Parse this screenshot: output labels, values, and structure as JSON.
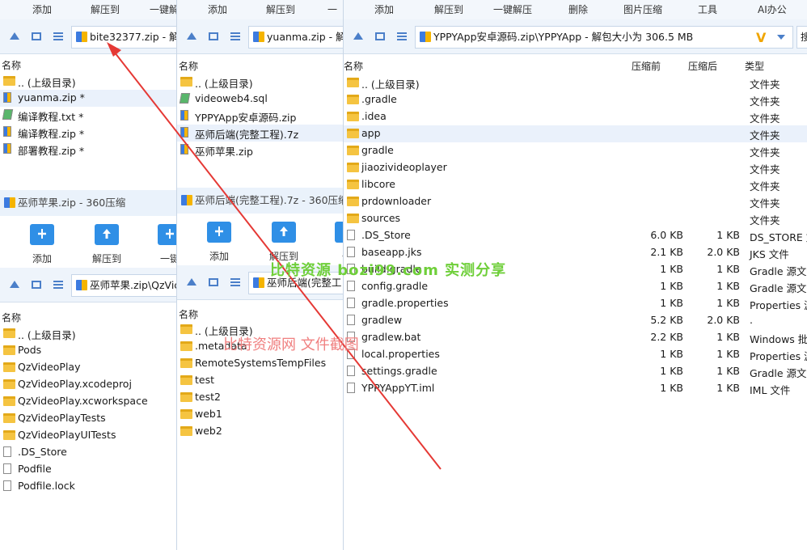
{
  "win1": {
    "toolbar": [
      "添加",
      "解压到",
      "一键解"
    ],
    "path": "bite32377.zip - 解",
    "col_name": "名称",
    "files": [
      {
        "name": ".. (上级目录)",
        "type": "folder"
      },
      {
        "name": "yuanma.zip *",
        "type": "zip",
        "selected": true
      },
      {
        "name": "编译教程.txt *",
        "type": "txt"
      },
      {
        "name": "编译教程.zip *",
        "type": "zip"
      },
      {
        "name": "部署教程.zip *",
        "type": "zip"
      }
    ]
  },
  "win2": {
    "toolbar": [
      "添加",
      "解压到",
      "一"
    ],
    "path": "yuanma.zip - 解",
    "col_name": "名称",
    "files": [
      {
        "name": ".. (上级目录)",
        "type": "folder"
      },
      {
        "name": "videoweb4.sql",
        "type": "txt"
      },
      {
        "name": "YPPYApp安卓源码.zip",
        "type": "zip"
      },
      {
        "name": "巫师后端(完整工程).7z",
        "type": "zip",
        "selected": true
      },
      {
        "name": "巫师苹果.zip",
        "type": "zip"
      }
    ]
  },
  "win3": {
    "title": "巫师苹果.zip - 360压缩",
    "buttons": [
      "添加",
      "解压到",
      "一键"
    ],
    "path": "巫师苹果.zip\\QzVic",
    "col_name": "名称",
    "files": [
      {
        "name": ".. (上级目录)",
        "type": "folder"
      },
      {
        "name": "Pods",
        "type": "folder"
      },
      {
        "name": "QzVideoPlay",
        "type": "folder"
      },
      {
        "name": "QzVideoPlay.xcodeproj",
        "type": "folder"
      },
      {
        "name": "QzVideoPlay.xcworkspace",
        "type": "folder"
      },
      {
        "name": "QzVideoPlayTests",
        "type": "folder"
      },
      {
        "name": "QzVideoPlayUITests",
        "type": "folder"
      },
      {
        "name": ".DS_Store",
        "type": "file"
      },
      {
        "name": "Podfile",
        "type": "file"
      },
      {
        "name": "Podfile.lock",
        "type": "file"
      }
    ]
  },
  "win4": {
    "title": "巫师后端(完整工程).7z - 360压缩",
    "buttons": [
      "添加",
      "解压到",
      "一"
    ],
    "path": "巫师后端(完整工",
    "col_name": "名称",
    "files": [
      {
        "name": ".. (上级目录)",
        "type": "folder"
      },
      {
        "name": ".metadata",
        "type": "folder"
      },
      {
        "name": "RemoteSystemsTempFiles",
        "type": "folder"
      },
      {
        "name": "test",
        "type": "folder"
      },
      {
        "name": "test2",
        "type": "folder"
      },
      {
        "name": "web1",
        "type": "folder"
      },
      {
        "name": "web2",
        "type": "folder"
      }
    ]
  },
  "win5": {
    "toolbar": [
      "添加",
      "解压到",
      "一键解压",
      "删除",
      "图片压缩",
      "工具",
      "AI办公"
    ],
    "path": "YPPYApp安卓源码.zip\\YPPYApp - 解包大小为 306.5 MB",
    "search_placeholder": "搜",
    "columns": {
      "name": "名称",
      "before": "压缩前",
      "after": "压缩后",
      "type": "类型"
    },
    "files": [
      {
        "name": ".. (上级目录)",
        "before": "",
        "after": "",
        "type": "文件夹",
        "icon": "folder"
      },
      {
        "name": ".gradle",
        "before": "",
        "after": "",
        "type": "文件夹",
        "icon": "folder"
      },
      {
        "name": ".idea",
        "before": "",
        "after": "",
        "type": "文件夹",
        "icon": "folder"
      },
      {
        "name": "app",
        "before": "",
        "after": "",
        "type": "文件夹",
        "icon": "folder",
        "selected": true
      },
      {
        "name": "gradle",
        "before": "",
        "after": "",
        "type": "文件夹",
        "icon": "folder"
      },
      {
        "name": "jiaozivideoplayer",
        "before": "",
        "after": "",
        "type": "文件夹",
        "icon": "folder"
      },
      {
        "name": "libcore",
        "before": "",
        "after": "",
        "type": "文件夹",
        "icon": "folder"
      },
      {
        "name": "prdownloader",
        "before": "",
        "after": "",
        "type": "文件夹",
        "icon": "folder"
      },
      {
        "name": "sources",
        "before": "",
        "after": "",
        "type": "文件夹",
        "icon": "folder"
      },
      {
        "name": ".DS_Store",
        "before": "6.0 KB",
        "after": "1 KB",
        "type": "DS_STORE 文",
        "icon": "file"
      },
      {
        "name": "baseapp.jks",
        "before": "2.1 KB",
        "after": "2.0 KB",
        "type": "JKS 文件",
        "icon": "file"
      },
      {
        "name": "build.gradle",
        "before": "1 KB",
        "after": "1 KB",
        "type": "Gradle 源文件",
        "icon": "file"
      },
      {
        "name": "config.gradle",
        "before": "1 KB",
        "after": "1 KB",
        "type": "Gradle 源文件",
        "icon": "file"
      },
      {
        "name": "gradle.properties",
        "before": "1 KB",
        "after": "1 KB",
        "type": "Properties 源",
        "icon": "file"
      },
      {
        "name": "gradlew",
        "before": "5.2 KB",
        "after": "2.0 KB",
        "type": ".",
        "icon": "file"
      },
      {
        "name": "gradlew.bat",
        "before": "2.2 KB",
        "after": "1 KB",
        "type": "Windows 批处",
        "icon": "file"
      },
      {
        "name": "local.properties",
        "before": "1 KB",
        "after": "1 KB",
        "type": "Properties 源",
        "icon": "file"
      },
      {
        "name": "settings.gradle",
        "before": "1 KB",
        "after": "1 KB",
        "type": "Gradle 源文件",
        "icon": "file"
      },
      {
        "name": "YPPYAppYT.iml",
        "before": "1 KB",
        "after": "1 KB",
        "type": "IML 文件",
        "icon": "file"
      }
    ]
  },
  "watermark_site": "比特资源  bozi99.com  实测分享",
  "watermark_caption": "比特资源网  文件截图"
}
